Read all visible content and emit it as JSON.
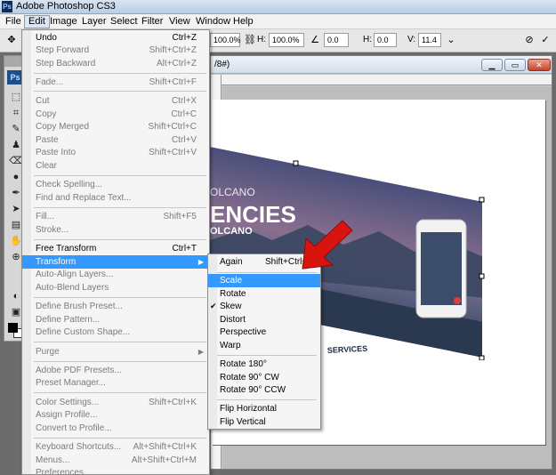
{
  "app": {
    "title": "Adobe Photoshop CS3",
    "logo": "Ps"
  },
  "menubar": {
    "items": [
      "File",
      "Edit",
      "Image",
      "Layer",
      "Select",
      "Filter",
      "View",
      "Window",
      "Help"
    ]
  },
  "options_bar": {
    "w_value": "100.0%",
    "h_label": "H:",
    "h_value": "100.0%",
    "angle_value": "0.0",
    "hskew_label": "H:",
    "hskew_value": "0.0",
    "vskew_label": "V:",
    "vskew_value": "11.4"
  },
  "document": {
    "title_fragment": "/8#)"
  },
  "image_text": {
    "line1": "OLCANO",
    "line2": "ENCIES",
    "line3": "OLCANO",
    "services": "SERVICES"
  },
  "edit_menu": {
    "items": [
      {
        "label": "Undo",
        "shortcut": "Ctrl+Z",
        "disabled": false
      },
      {
        "label": "Step Forward",
        "shortcut": "Shift+Ctrl+Z",
        "disabled": true
      },
      {
        "label": "Step Backward",
        "shortcut": "Alt+Ctrl+Z",
        "disabled": true
      },
      {
        "label": "Fade...",
        "shortcut": "Shift+Ctrl+F",
        "disabled": true
      },
      {
        "label": "Cut",
        "shortcut": "Ctrl+X",
        "disabled": true
      },
      {
        "label": "Copy",
        "shortcut": "Ctrl+C",
        "disabled": true
      },
      {
        "label": "Copy Merged",
        "shortcut": "Shift+Ctrl+C",
        "disabled": true
      },
      {
        "label": "Paste",
        "shortcut": "Ctrl+V",
        "disabled": true
      },
      {
        "label": "Paste Into",
        "shortcut": "Shift+Ctrl+V",
        "disabled": true
      },
      {
        "label": "Clear",
        "shortcut": "",
        "disabled": true
      },
      {
        "label": "Check Spelling...",
        "shortcut": "",
        "disabled": true
      },
      {
        "label": "Find and Replace Text...",
        "shortcut": "",
        "disabled": true
      },
      {
        "label": "Fill...",
        "shortcut": "Shift+F5",
        "disabled": true
      },
      {
        "label": "Stroke...",
        "shortcut": "",
        "disabled": true
      },
      {
        "label": "Free Transform",
        "shortcut": "Ctrl+T",
        "disabled": false
      },
      {
        "label": "Transform",
        "shortcut": "",
        "disabled": false
      },
      {
        "label": "Auto-Align Layers...",
        "shortcut": "",
        "disabled": true
      },
      {
        "label": "Auto-Blend Layers",
        "shortcut": "",
        "disabled": true
      },
      {
        "label": "Define Brush Preset...",
        "shortcut": "",
        "disabled": true
      },
      {
        "label": "Define Pattern...",
        "shortcut": "",
        "disabled": true
      },
      {
        "label": "Define Custom Shape...",
        "shortcut": "",
        "disabled": true
      },
      {
        "label": "Purge",
        "shortcut": "",
        "disabled": true
      },
      {
        "label": "Adobe PDF Presets...",
        "shortcut": "",
        "disabled": true
      },
      {
        "label": "Preset Manager...",
        "shortcut": "",
        "disabled": true
      },
      {
        "label": "Color Settings...",
        "shortcut": "Shift+Ctrl+K",
        "disabled": true
      },
      {
        "label": "Assign Profile...",
        "shortcut": "",
        "disabled": true
      },
      {
        "label": "Convert to Profile...",
        "shortcut": "",
        "disabled": true
      },
      {
        "label": "Keyboard Shortcuts...",
        "shortcut": "Alt+Shift+Ctrl+K",
        "disabled": true
      },
      {
        "label": "Menus...",
        "shortcut": "Alt+Shift+Ctrl+M",
        "disabled": true
      },
      {
        "label": "Preferences",
        "shortcut": "",
        "disabled": true
      }
    ]
  },
  "transform_menu": {
    "items": [
      {
        "label": "Again",
        "shortcut": "Shift+Ctrl+T",
        "checked": false
      },
      {
        "label": "Scale",
        "shortcut": "",
        "checked": false
      },
      {
        "label": "Rotate",
        "shortcut": "",
        "checked": false
      },
      {
        "label": "Skew",
        "shortcut": "",
        "checked": true
      },
      {
        "label": "Distort",
        "shortcut": "",
        "checked": false
      },
      {
        "label": "Perspective",
        "shortcut": "",
        "checked": false
      },
      {
        "label": "Warp",
        "shortcut": "",
        "checked": false
      },
      {
        "label": "Rotate 180°",
        "shortcut": "",
        "checked": false
      },
      {
        "label": "Rotate 90° CW",
        "shortcut": "",
        "checked": false
      },
      {
        "label": "Rotate 90° CCW",
        "shortcut": "",
        "checked": false
      },
      {
        "label": "Flip Horizontal",
        "shortcut": "",
        "checked": false
      },
      {
        "label": "Flip Vertical",
        "shortcut": "",
        "checked": false
      }
    ]
  },
  "colors": {
    "highlight": "#3399ff",
    "arrow": "#d8140f"
  }
}
